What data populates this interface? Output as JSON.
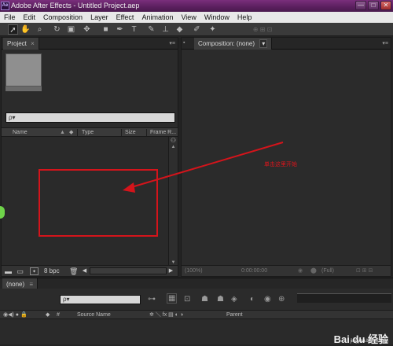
{
  "window": {
    "title": "Adobe After Effects - Untitled Project.aep",
    "logo_text": "Ae",
    "controls": [
      "—",
      "□",
      "✕"
    ]
  },
  "menu": [
    "File",
    "Edit",
    "Composition",
    "Layer",
    "Effect",
    "Animation",
    "View",
    "Window",
    "Help"
  ],
  "toolbar": {
    "tools": [
      "selection-tool",
      "hand-tool",
      "zoom-tool",
      "rotate-tool",
      "camera-tool",
      "pan-behind-tool",
      "rectangle-tool",
      "pen-tool",
      "type-tool",
      "brush-tool",
      "clone-tool",
      "eraser-tool",
      "roto-tool",
      "puppet-tool"
    ]
  },
  "project_panel": {
    "tab_label": "Project",
    "tab_close": "×",
    "search_placeholder": "ρ▾",
    "columns": [
      "Name",
      "Type",
      "Size",
      "Frame R..."
    ],
    "footer": {
      "bpc_label": "8 bpc"
    }
  },
  "composition_panel": {
    "tab_label": "Composition: (none)",
    "tab_dropdown": "▾",
    "footer": {
      "zoom": "(100%)",
      "timecode": "0:00:00:00",
      "resolution": "(Full)"
    }
  },
  "annotation": {
    "note": "单击这里开始",
    "color": "#d4141b"
  },
  "timeline": {
    "tab_label": "(none)",
    "search_placeholder": "ρ▾",
    "columns": [
      "Source Name",
      "Parent"
    ]
  },
  "watermark": {
    "brand": "Bai du 经验",
    "url": "jingyan.baidu.com"
  }
}
